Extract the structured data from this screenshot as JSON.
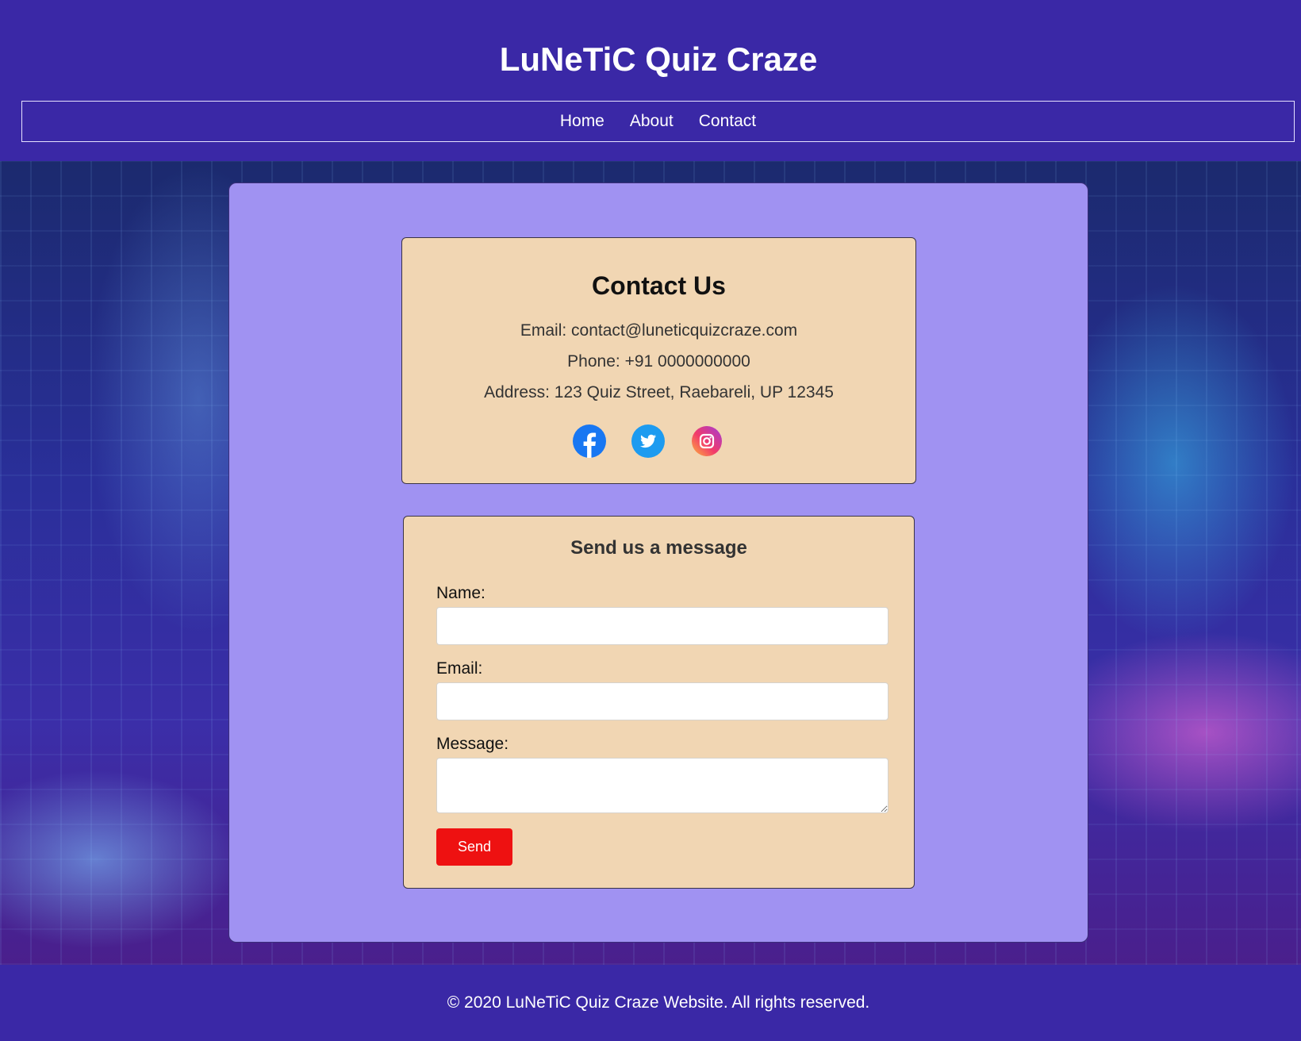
{
  "header": {
    "title": "LuNeTiC Quiz Craze",
    "nav": [
      "Home",
      "About",
      "Contact"
    ]
  },
  "contact": {
    "heading": "Contact Us",
    "email_line": "Email: contact@luneticquizcraze.com",
    "phone_line": "Phone: +91 0000000000",
    "address_line": "Address: 123 Quiz Street, Raebareli, UP 12345",
    "social_icons": [
      "facebook-icon",
      "twitter-icon",
      "instagram-icon"
    ]
  },
  "form": {
    "heading": "Send us a message",
    "name_label": "Name:",
    "name_value": "",
    "email_label": "Email:",
    "email_value": "",
    "message_label": "Message:",
    "message_value": "",
    "send_label": "Send"
  },
  "footer": {
    "text": "© 2020 LuNeTiC Quiz Craze Website. All rights reserved."
  },
  "colors": {
    "header_bg": "#3a28a6",
    "panel_bg": "#a092f2",
    "card_bg": "#f1d6b3",
    "send_button": "#ee1111",
    "facebook": "#1877f2",
    "twitter": "#1d9bf0"
  }
}
